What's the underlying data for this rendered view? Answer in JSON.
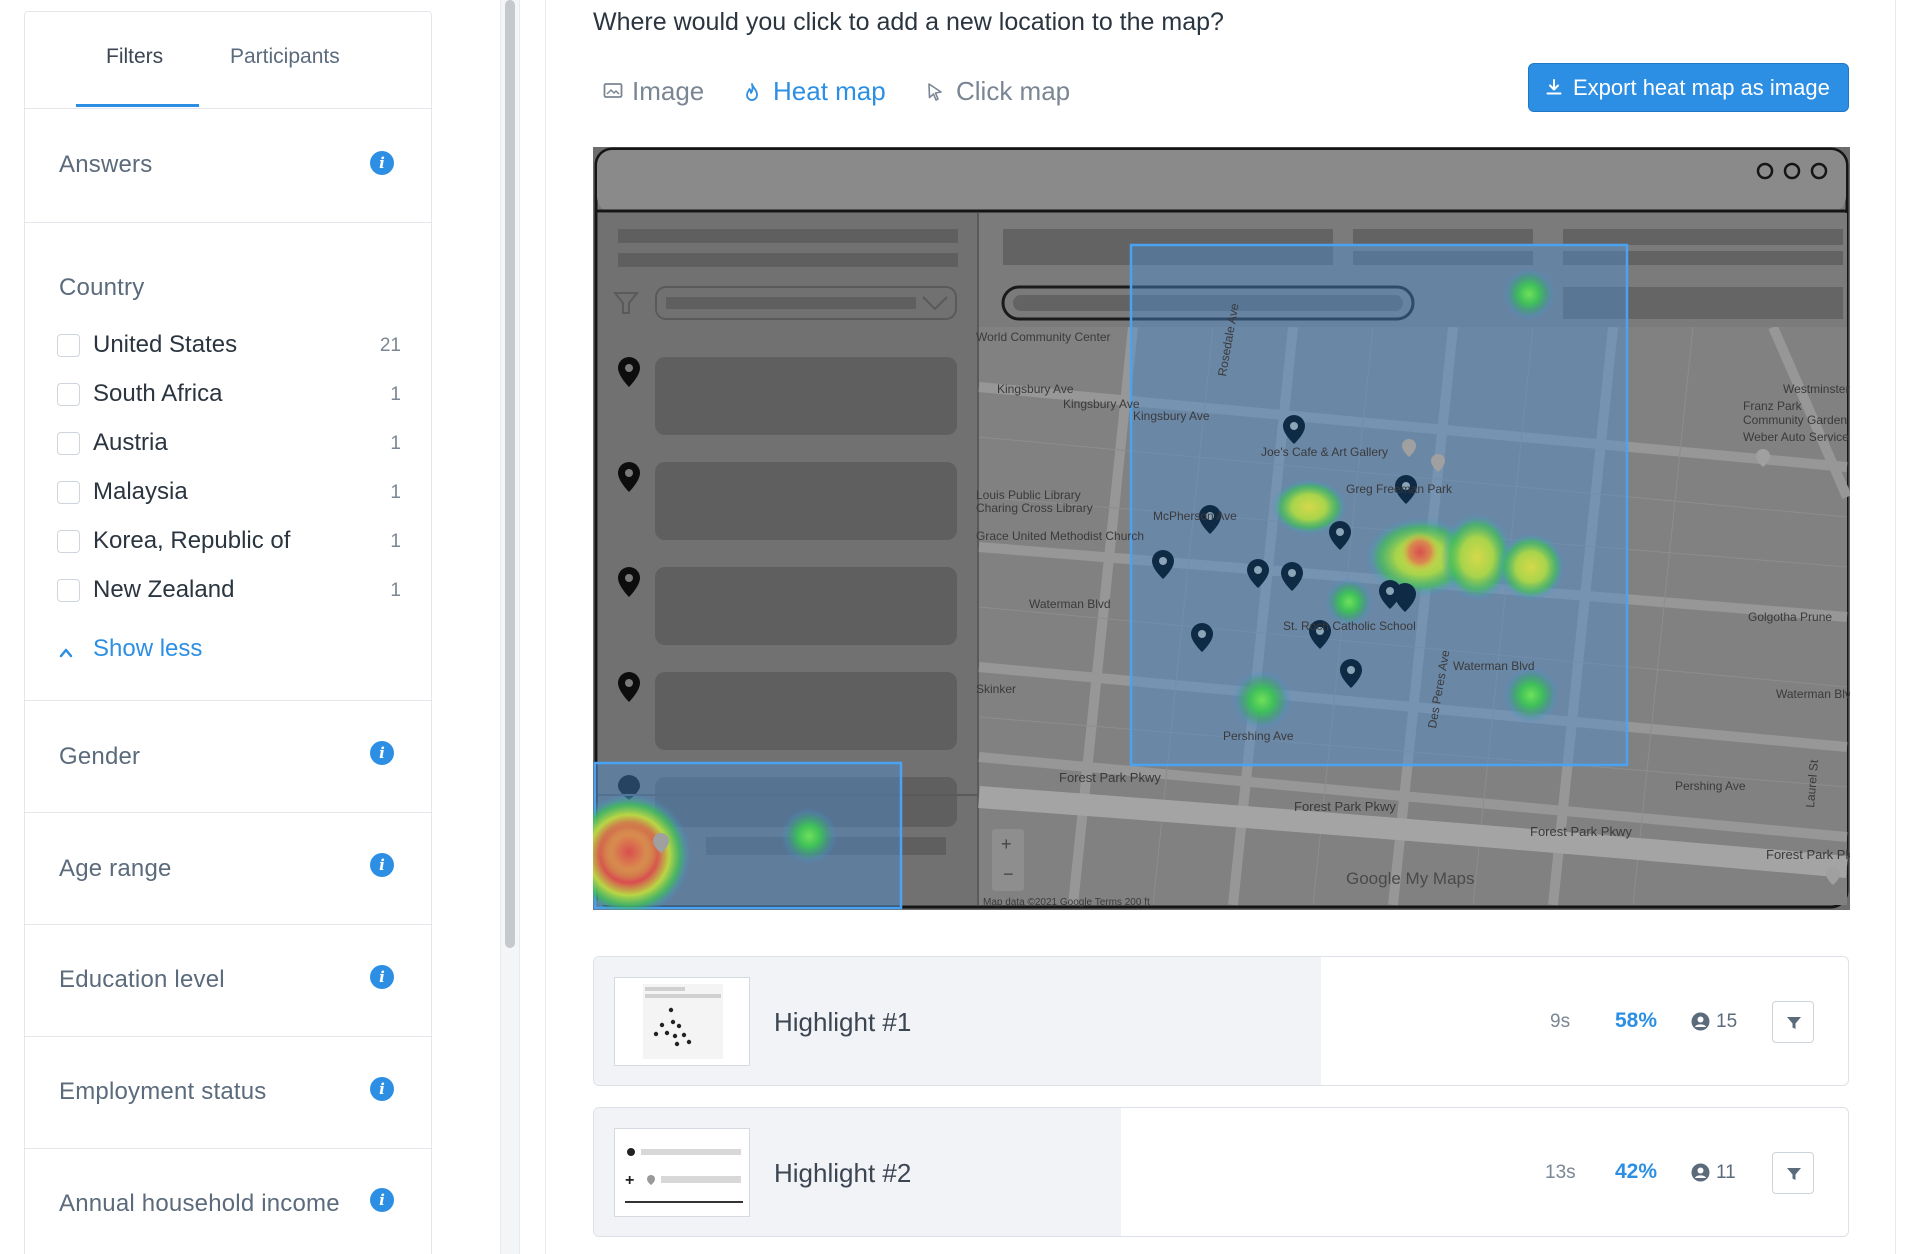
{
  "filter_panel": {
    "tabs": [
      "Filters",
      "Participants"
    ],
    "active_tab": "Filters",
    "sections": {
      "answers": "Answers",
      "country": "Country",
      "gender": "Gender",
      "age_range": "Age range",
      "education_level": "Education level",
      "employment_status": "Employment status",
      "annual_household_income": "Annual household income"
    },
    "countries": [
      {
        "name": "United States",
        "count": "21"
      },
      {
        "name": "South Africa",
        "count": "1"
      },
      {
        "name": "Austria",
        "count": "1"
      },
      {
        "name": "Malaysia",
        "count": "1"
      },
      {
        "name": "Korea, Republic of",
        "count": "1"
      },
      {
        "name": "New Zealand",
        "count": "1"
      }
    ],
    "show_less_label": "Show less",
    "info_icon_glyph": "i"
  },
  "main": {
    "question": "Where would you click to add a new location to the map?",
    "view_tabs": [
      {
        "label": "Image",
        "icon": "image-icon"
      },
      {
        "label": "Heat map",
        "icon": "flame-icon"
      },
      {
        "label": "Click map",
        "icon": "cursor-icon"
      }
    ],
    "active_view": "Heat map",
    "export_label": "Export heat map as image"
  },
  "map": {
    "street_labels": [
      "World Community Center",
      "Kingsbury Ave",
      "Kingsbury Ave",
      "Kingsbury Ave",
      "Joe's Cafe & Art Gallery",
      "Greg Freeman Park",
      "Louis Public Library",
      "Charing Cross Library",
      "Grace United Methodist Church",
      "Waterman Blvd",
      "St. Roch Catholic School",
      "Waterman Blvd",
      "Waterman Blvd",
      "Forest Park Pkwy",
      "Forest Park Pkwy",
      "Forest Park Pkwy",
      "Forest Park Pkwy",
      "Pershing Ave",
      "Pershing Ave",
      "Golgotha Prune",
      "Franz Park Community Garden",
      "Weber Auto Service",
      "Westminster",
      "Skinker",
      "McPherson Ave",
      "Rosedale Ave",
      "Des Peres Ave",
      "Laurel St"
    ],
    "attribution": "Google My Maps",
    "map_data": "Map data ©2021 Google   Terms   200 ft"
  },
  "highlights": [
    {
      "title": "Highlight #1",
      "time": "9s",
      "percent": "58%",
      "users": "15",
      "percent_value": 58
    },
    {
      "title": "Highlight #2",
      "time": "13s",
      "percent": "42%",
      "users": "11",
      "percent_value": 42
    }
  ],
  "colors": {
    "accent": "#2d8fe3",
    "heat_hot": "#d94f4f",
    "heat_warm": "#b9d645",
    "heat_cool": "#3fbf5a",
    "selection": "#4a9fe8"
  }
}
